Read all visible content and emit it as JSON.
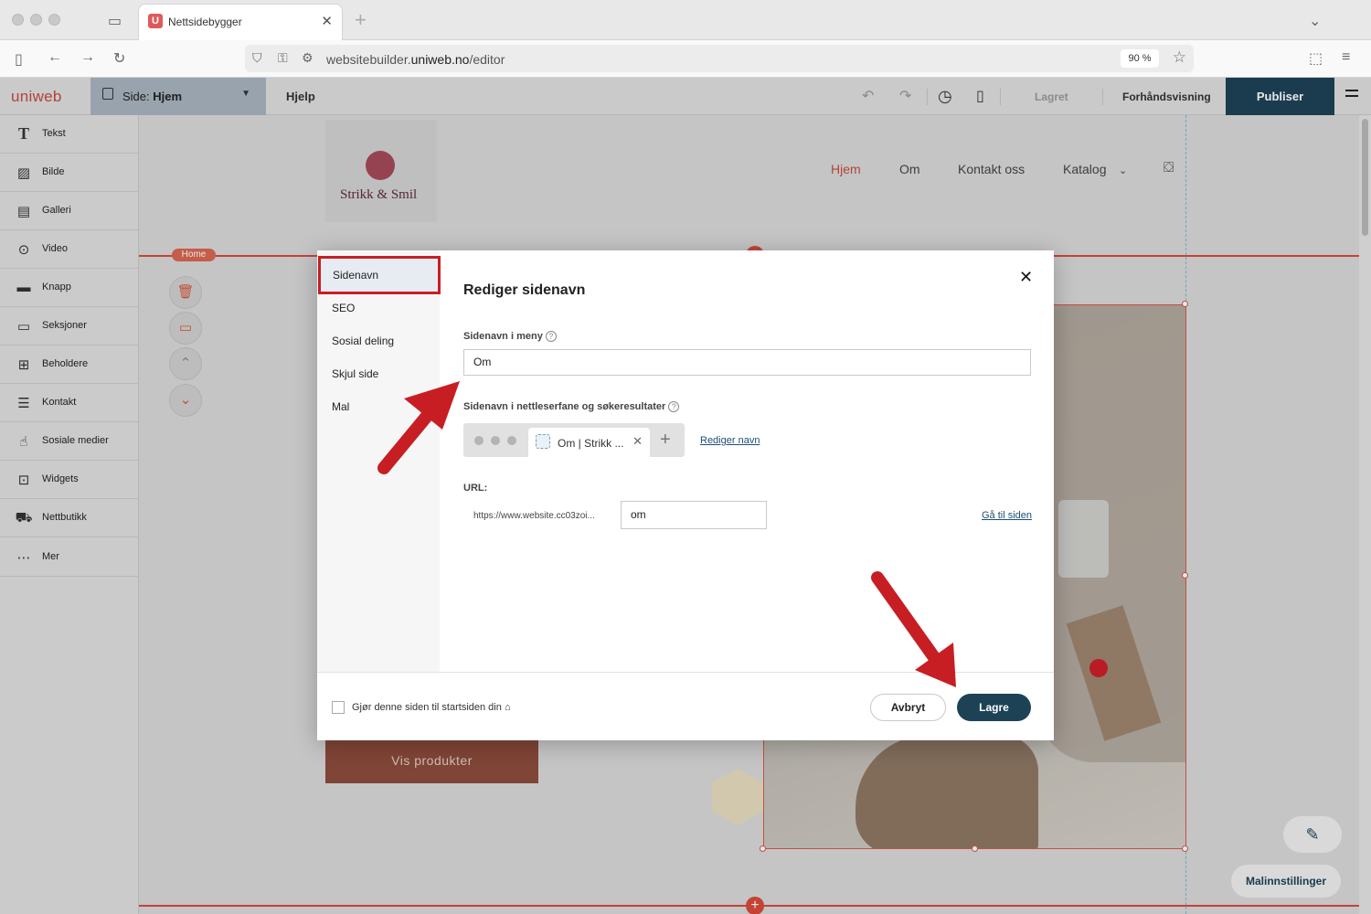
{
  "browser": {
    "tab_title": "Nettsidebygger",
    "tab_favicon": "U",
    "url_prefix": "websitebuilder.",
    "url_domain": "uniweb.no",
    "url_path": "/editor",
    "zoom": "90 %"
  },
  "editor": {
    "brand": "uniweb",
    "page_selector_label": "Side: ",
    "page_selector_value": "Hjem",
    "help": "Hjelp",
    "status": "Lagret",
    "preview": "Forhåndsvisning",
    "publish": "Publiser"
  },
  "sidebar": {
    "items": [
      {
        "label": "Tekst",
        "icon": "text-icon"
      },
      {
        "label": "Bilde",
        "icon": "image-icon"
      },
      {
        "label": "Galleri",
        "icon": "gallery-icon"
      },
      {
        "label": "Video",
        "icon": "video-icon"
      },
      {
        "label": "Knapp",
        "icon": "button-icon"
      },
      {
        "label": "Seksjoner",
        "icon": "sections-icon"
      },
      {
        "label": "Beholdere",
        "icon": "containers-icon"
      },
      {
        "label": "Kontakt",
        "icon": "contact-icon"
      },
      {
        "label": "Sosiale medier",
        "icon": "thumbs-up-icon"
      },
      {
        "label": "Widgets",
        "icon": "widgets-icon"
      },
      {
        "label": "Nettbutikk",
        "icon": "cart-icon"
      },
      {
        "label": "Mer",
        "icon": "more-icon"
      }
    ]
  },
  "site": {
    "logo_text": "Strikk & Smil",
    "nav": [
      "Hjem",
      "Om",
      "Kontakt oss",
      "Katalog"
    ],
    "section_badge": "Home",
    "cta": "Vis produkter"
  },
  "modal": {
    "nav": [
      "Sidenavn",
      "SEO",
      "Sosial deling",
      "Skjul side",
      "Mal"
    ],
    "title": "Rediger sidenavn",
    "menu_name_label": "Sidenavn i meny",
    "menu_name_value": "Om",
    "browser_name_label": "Sidenavn i nettleserfane og søkeresultater",
    "browser_tab_preview": "Om | Strikk ...",
    "edit_name_link": "Rediger navn",
    "url_label": "URL:",
    "url_base": "https://www.website.cc03zoi...",
    "url_slug": "om",
    "goto_link": "Gå til siden",
    "startpage_checkbox": "Gjør denne siden til startsiden din",
    "cancel": "Avbryt",
    "save": "Lagre"
  },
  "floating": {
    "theme_settings": "Malinnstillinger"
  },
  "colors": {
    "accent": "#1d4256",
    "brand_red": "#c5493e",
    "section_line": "#d94a3a",
    "annotation_red": "#c71e24"
  }
}
